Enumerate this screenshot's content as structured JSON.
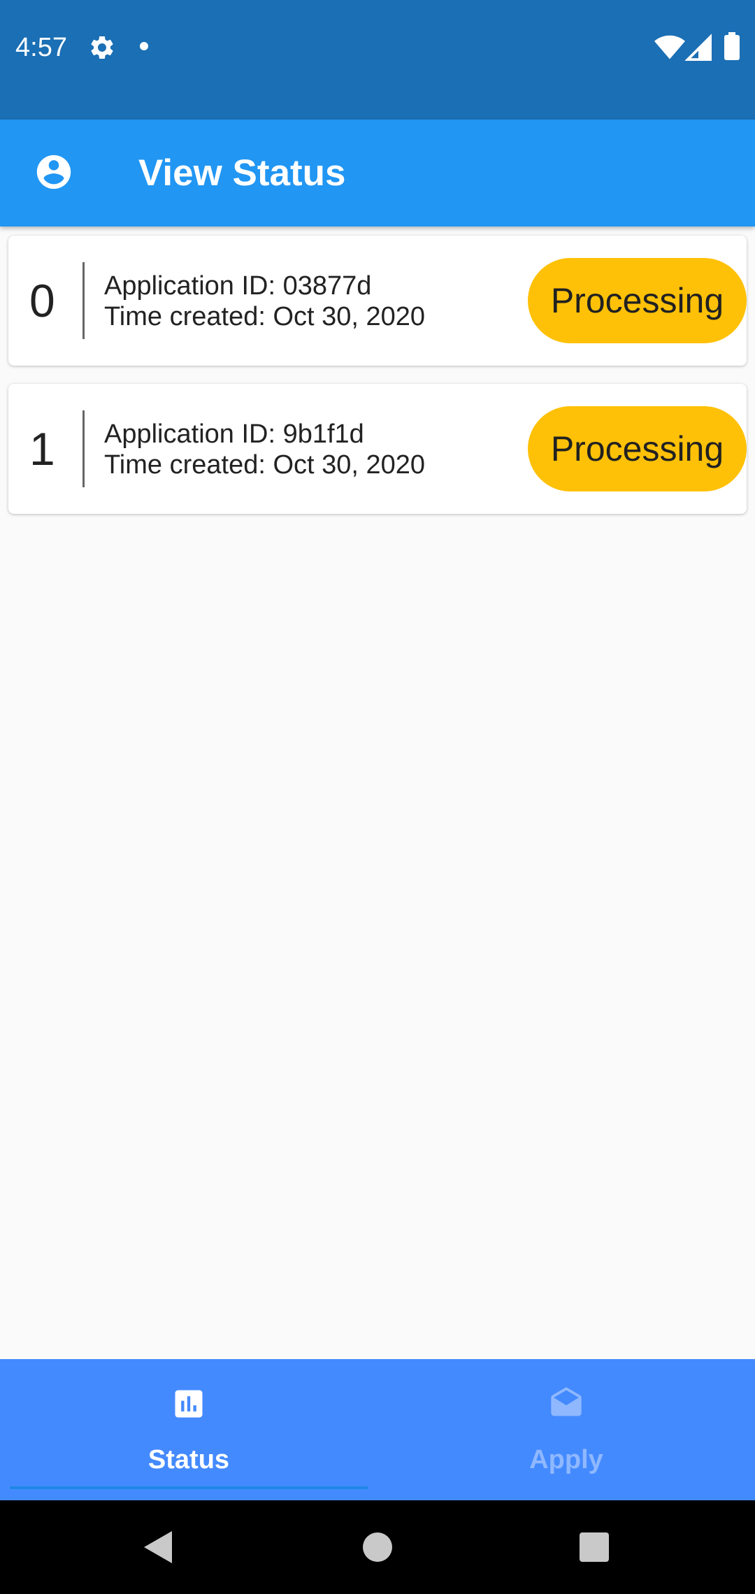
{
  "status_bar": {
    "time": "4:57"
  },
  "app_bar": {
    "title": "View Status"
  },
  "applications": [
    {
      "index": "0",
      "id_text": "Application ID: 03877d",
      "time_text": "Time created: Oct 30, 2020",
      "status": "Processing"
    },
    {
      "index": "1",
      "id_text": "Application ID: 9b1f1d",
      "time_text": "Time created: Oct 30, 2020",
      "status": "Processing"
    }
  ],
  "bottom_nav": {
    "items": [
      {
        "label": "Status",
        "icon": "bar-chart-icon",
        "selected": true
      },
      {
        "label": "Apply",
        "icon": "drafts-icon",
        "selected": false
      }
    ]
  },
  "colors": {
    "status_bar": "#1a6fb5",
    "app_bar": "#2196f3",
    "badge": "#ffc107",
    "bottom_nav": "#448aff"
  }
}
